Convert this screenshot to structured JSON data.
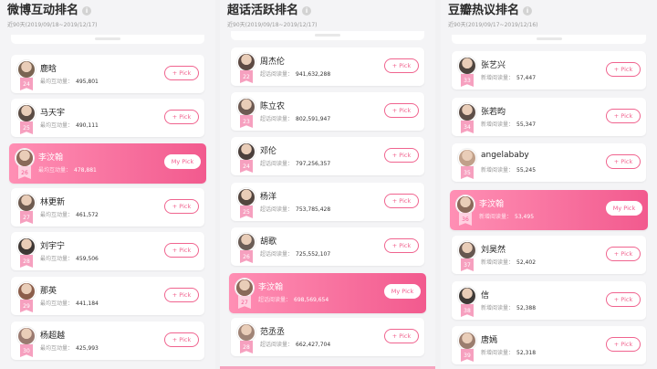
{
  "columns": [
    {
      "title": "微博互动排名",
      "subtitle": "近90天(2019/09/18~2019/12/17)",
      "stat_label": "最均互动量：",
      "items": [
        {
          "name": "鹿晗",
          "value": "495,801",
          "rank": "24",
          "highlight": false,
          "button": "+ Pick",
          "avatar_color": "#7a6452"
        },
        {
          "name": "马天宇",
          "value": "490,111",
          "rank": "25",
          "highlight": false,
          "button": "+ Pick",
          "avatar_color": "#5b4c44"
        },
        {
          "name": "李汶翰",
          "value": "478,881",
          "rank": "26",
          "highlight": true,
          "button": "My Pick",
          "avatar_color": "#8a6a5a"
        },
        {
          "name": "林更新",
          "value": "461,572",
          "rank": "27",
          "highlight": false,
          "button": "+ Pick",
          "avatar_color": "#6e5b50"
        },
        {
          "name": "刘宇宁",
          "value": "459,506",
          "rank": "28",
          "highlight": false,
          "button": "+ Pick",
          "avatar_color": "#3e3734"
        },
        {
          "name": "那英",
          "value": "441,184",
          "rank": "29",
          "highlight": false,
          "button": "+ Pick",
          "avatar_color": "#8b5e4b"
        },
        {
          "name": "杨超越",
          "value": "425,993",
          "rank": "30",
          "highlight": false,
          "button": "+ Pick",
          "avatar_color": "#9a7a70"
        }
      ]
    },
    {
      "title": "超话活跃排名",
      "subtitle": "近90天(2019/09/18~2019/12/17)",
      "stat_label": "超话阅读量：",
      "items": [
        {
          "name": "周杰伦",
          "value": "941,632,288",
          "rank": "22",
          "highlight": false,
          "button": "+ Pick",
          "avatar_color": "#5d4a43"
        },
        {
          "name": "陈立农",
          "value": "802,591,947",
          "rank": "23",
          "highlight": false,
          "button": "+ Pick",
          "avatar_color": "#6d5a52"
        },
        {
          "name": "邓伦",
          "value": "797,256,357",
          "rank": "24",
          "highlight": false,
          "button": "+ Pick",
          "avatar_color": "#4b403c"
        },
        {
          "name": "杨洋",
          "value": "753,785,428",
          "rank": "25",
          "highlight": false,
          "button": "+ Pick",
          "avatar_color": "#54463f"
        },
        {
          "name": "胡歌",
          "value": "725,552,107",
          "rank": "26",
          "highlight": false,
          "button": "+ Pick",
          "avatar_color": "#6b5d56"
        },
        {
          "name": "李汶翰",
          "value": "698,569,654",
          "rank": "27",
          "highlight": true,
          "button": "My Pick",
          "avatar_color": "#8a6a5a"
        },
        {
          "name": "范丞丞",
          "value": "662,427,704",
          "rank": "28",
          "highlight": false,
          "button": "+ Pick",
          "avatar_color": "#a08476"
        }
      ]
    },
    {
      "title": "豆瓣热议排名",
      "subtitle": "近90天(2019/09/17~2019/12/16)",
      "stat_label": "新增阅读量：",
      "items": [
        {
          "name": "张艺兴",
          "value": "57,447",
          "rank": "33",
          "highlight": false,
          "button": "+ Pick",
          "avatar_color": "#4f453f"
        },
        {
          "name": "张若昀",
          "value": "55,347",
          "rank": "34",
          "highlight": false,
          "button": "+ Pick",
          "avatar_color": "#5e4f48"
        },
        {
          "name": "angelababy",
          "value": "55,245",
          "rank": "35",
          "highlight": false,
          "button": "+ Pick",
          "avatar_color": "#c0a08a"
        },
        {
          "name": "李汶翰",
          "value": "53,495",
          "rank": "36",
          "highlight": true,
          "button": "My Pick",
          "avatar_color": "#8a6a5a"
        },
        {
          "name": "刘昊然",
          "value": "52,402",
          "rank": "37",
          "highlight": false,
          "button": "+ Pick",
          "avatar_color": "#665750"
        },
        {
          "name": "信",
          "value": "52,388",
          "rank": "38",
          "highlight": false,
          "button": "+ Pick",
          "avatar_color": "#3f3a37"
        },
        {
          "name": "唐嫣",
          "value": "52,318",
          "rank": "39",
          "highlight": false,
          "button": "+ Pick",
          "avatar_color": "#9b7d6e"
        }
      ]
    }
  ]
}
